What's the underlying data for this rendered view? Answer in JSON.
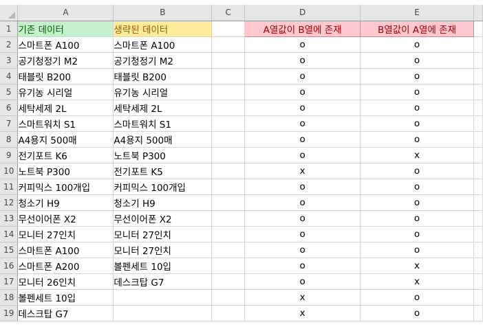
{
  "columns": [
    "A",
    "B",
    "C",
    "D",
    "E"
  ],
  "header_row": {
    "num": "1",
    "a": "기존 데이터",
    "b": "생략된 데이터",
    "c": "",
    "d": "A열값이 B열에 존재",
    "e": "B열값이 A열에 존재"
  },
  "header_colors": {
    "a_fill": "#c6efce",
    "a_text": "#006100",
    "b_fill": "#ffeb9c",
    "b_text": "#9c5700",
    "de_fill": "#ffc7ce",
    "de_text": "#9c0006"
  },
  "rows": [
    {
      "num": "2",
      "a": "스마트폰 A100",
      "b": "스마트폰 A100",
      "c": "",
      "d": "o",
      "e": "o"
    },
    {
      "num": "3",
      "a": "공기청정기 M2",
      "b": "공기청정기 M2",
      "c": "",
      "d": "o",
      "e": "o"
    },
    {
      "num": "4",
      "a": "태블릿 B200",
      "b": "태블릿 B200",
      "c": "",
      "d": "o",
      "e": "o"
    },
    {
      "num": "5",
      "a": "유기농 시리얼",
      "b": "유기농 시리얼",
      "c": "",
      "d": "o",
      "e": "o"
    },
    {
      "num": "6",
      "a": "세탁세제 2L",
      "b": "세탁세제 2L",
      "c": "",
      "d": "o",
      "e": "o"
    },
    {
      "num": "7",
      "a": "스마트워치 S1",
      "b": "스마트워치 S1",
      "c": "",
      "d": "o",
      "e": "o"
    },
    {
      "num": "8",
      "a": "A4용지 500매",
      "b": "A4용지 500매",
      "c": "",
      "d": "o",
      "e": "o"
    },
    {
      "num": "9",
      "a": "전기포트 K6",
      "b": "노트북 P300",
      "c": "",
      "d": "o",
      "e": "x"
    },
    {
      "num": "10",
      "a": "노트북 P300",
      "b": "전기포트 K5",
      "c": "",
      "d": "x",
      "e": "o"
    },
    {
      "num": "11",
      "a": "커피믹스 100개입",
      "b": "커피믹스 100개입",
      "c": "",
      "d": "o",
      "e": "o"
    },
    {
      "num": "12",
      "a": "청소기 H9",
      "b": "청소기 H9",
      "c": "",
      "d": "o",
      "e": "o"
    },
    {
      "num": "13",
      "a": "무선이어폰 X2",
      "b": "무선이어폰 X2",
      "c": "",
      "d": "o",
      "e": "o"
    },
    {
      "num": "14",
      "a": "모니터 27인치",
      "b": "모니터 27인치",
      "c": "",
      "d": "o",
      "e": "o"
    },
    {
      "num": "15",
      "a": "스마트폰 A100",
      "b": "모니터 27인치",
      "c": "",
      "d": "o",
      "e": "o"
    },
    {
      "num": "16",
      "a": "스마트폰 A200",
      "b": "볼펜세트 10입",
      "c": "",
      "d": "o",
      "e": "x"
    },
    {
      "num": "17",
      "a": "모니터 26인치",
      "b": "데스크탑 G7",
      "c": "",
      "d": "o",
      "e": "x"
    },
    {
      "num": "18",
      "a": "볼펜세트 10입",
      "b": "",
      "c": "",
      "d": "x",
      "e": "o"
    },
    {
      "num": "19",
      "a": "데스크탑 G7",
      "b": "",
      "c": "",
      "d": "x",
      "e": "o"
    }
  ]
}
